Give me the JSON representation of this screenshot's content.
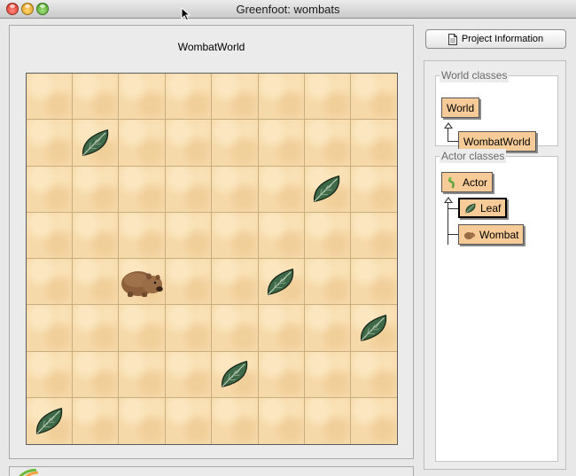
{
  "window": {
    "title": "Greenfoot: wombats"
  },
  "world": {
    "title": "WombatWorld",
    "columns": 8,
    "rows": 8,
    "cell_color": "#f6d9a8",
    "actors": [
      {
        "type": "leaf",
        "col": 1,
        "row": 1
      },
      {
        "type": "leaf",
        "col": 6,
        "row": 2
      },
      {
        "type": "wombat",
        "col": 2,
        "row": 4
      },
      {
        "type": "leaf",
        "col": 5,
        "row": 4
      },
      {
        "type": "leaf",
        "col": 7,
        "row": 5
      },
      {
        "type": "leaf",
        "col": 4,
        "row": 6
      },
      {
        "type": "leaf",
        "col": 0,
        "row": 7
      }
    ]
  },
  "toolbar": {
    "project_info_label": "Project Information"
  },
  "world_classes": {
    "title": "World classes",
    "items": [
      {
        "label": "World",
        "icon": "none"
      },
      {
        "label": "WombatWorld",
        "icon": "none"
      }
    ]
  },
  "actor_classes": {
    "title": "Actor classes",
    "items": [
      {
        "label": "Actor",
        "icon": "actor-icon"
      },
      {
        "label": "Leaf",
        "icon": "leaf-icon",
        "selected": true
      },
      {
        "label": "Wombat",
        "icon": "wombat-icon"
      }
    ]
  },
  "colors": {
    "class_box": "#f6cb97",
    "leaf": "#3f6a48",
    "wombat": "#9a6a44"
  }
}
